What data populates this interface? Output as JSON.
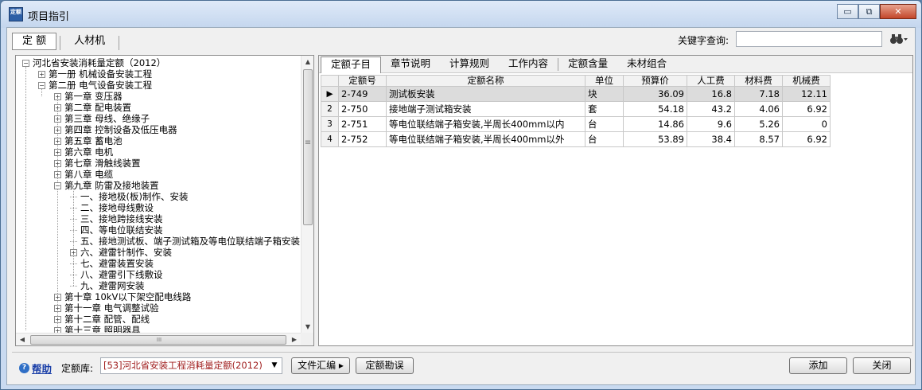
{
  "window": {
    "title": "项目指引",
    "app_icon_text": "定额",
    "controls": {
      "minimize": "▭",
      "restore": "⧉",
      "close": "✕"
    }
  },
  "top_tabs": [
    "定 额",
    "人材机"
  ],
  "keyword": {
    "label": "关键字查询:",
    "value": ""
  },
  "tree": [
    {
      "label": "河北省安装消耗量定额（2012）",
      "toggle": "−",
      "level": 0
    },
    {
      "label": "第一册  机械设备安装工程",
      "toggle": "+",
      "level": 1
    },
    {
      "label": "第二册  电气设备安装工程",
      "toggle": "−",
      "level": 1
    },
    {
      "label": "第一章  变压器",
      "toggle": "+",
      "level": 2
    },
    {
      "label": "第二章  配电装置",
      "toggle": "+",
      "level": 2
    },
    {
      "label": "第三章  母线、绝缘子",
      "toggle": "+",
      "level": 2
    },
    {
      "label": "第四章  控制设备及低压电器",
      "toggle": "+",
      "level": 2
    },
    {
      "label": "第五章  蓄电池",
      "toggle": "+",
      "level": 2
    },
    {
      "label": "第六章  电机",
      "toggle": "+",
      "level": 2
    },
    {
      "label": "第七章  滑触线装置",
      "toggle": "+",
      "level": 2
    },
    {
      "label": "第八章  电缆",
      "toggle": "+",
      "level": 2
    },
    {
      "label": "第九章  防雷及接地装置",
      "toggle": "−",
      "level": 2
    },
    {
      "label": "一、接地极(板)制作、安装",
      "toggle": "",
      "level": 3
    },
    {
      "label": "二、接地母线敷设",
      "toggle": "",
      "level": 3
    },
    {
      "label": "三、接地跨接线安装",
      "toggle": "",
      "level": 3
    },
    {
      "label": "四、等电位联结安装",
      "toggle": "",
      "level": 3
    },
    {
      "label": "五、接地测试板、端子测试箱及等电位联结端子箱安装",
      "toggle": "",
      "level": 3
    },
    {
      "label": "六、避雷针制作、安装",
      "toggle": "+",
      "level": 3
    },
    {
      "label": "七、避雷装置安装",
      "toggle": "",
      "level": 3
    },
    {
      "label": "八、避雷引下线敷设",
      "toggle": "",
      "level": 3
    },
    {
      "label": "九、避雷网安装",
      "toggle": "",
      "level": 3
    },
    {
      "label": "第十章  10kV以下架空配电线路",
      "toggle": "+",
      "level": 2
    },
    {
      "label": "第十一章  电气调整试验",
      "toggle": "+",
      "level": 2
    },
    {
      "label": "第十二章  配管、配线",
      "toggle": "+",
      "level": 2
    },
    {
      "label": "第十三章  照明器具",
      "toggle": "+",
      "level": 2
    }
  ],
  "sub_tabs": [
    "定额子目",
    "章节说明",
    "计算规则",
    "工作内容",
    "定额含量",
    "未材组合"
  ],
  "grid": {
    "columns": [
      "",
      "定额号",
      "定额名称",
      "单位",
      "预算价",
      "人工费",
      "材料费",
      "机械费"
    ],
    "rows": [
      {
        "marker": "▶",
        "code": "2-749",
        "name": "测试板安装",
        "unit": "块",
        "price": "36.09",
        "labor": "16.8",
        "material": "7.18",
        "machine": "12.11"
      },
      {
        "marker": "2",
        "code": "2-750",
        "name": "接地端子测试箱安装",
        "unit": "套",
        "price": "54.18",
        "labor": "43.2",
        "material": "4.06",
        "machine": "6.92"
      },
      {
        "marker": "3",
        "code": "2-751",
        "name": "等电位联结端子箱安装,半周长400mm以内",
        "unit": "台",
        "price": "14.86",
        "labor": "9.6",
        "material": "5.26",
        "machine": "0"
      },
      {
        "marker": "4",
        "code": "2-752",
        "name": "等电位联结端子箱安装,半周长400mm以外",
        "unit": "台",
        "price": "53.89",
        "labor": "38.4",
        "material": "8.57",
        "machine": "6.92"
      }
    ]
  },
  "footer": {
    "help_label": "帮助",
    "library_label": "定额库:",
    "library_value": "[53]河北省安装工程消耗量定额(2012)",
    "file_button": "文件汇编",
    "file_button_arrow": "▸",
    "errata_button": "定额勘误",
    "add_button": "添加",
    "close_button": "关闭"
  },
  "scroll_glyphs": {
    "up": "▲",
    "down": "▼",
    "left": "◀",
    "right": "▶",
    "grip_v": "≡",
    "grip_h": "III"
  },
  "colors": {
    "title_bar": "#c4d6ee",
    "library_text": "#a12020",
    "help_link": "#1a3fa8"
  }
}
